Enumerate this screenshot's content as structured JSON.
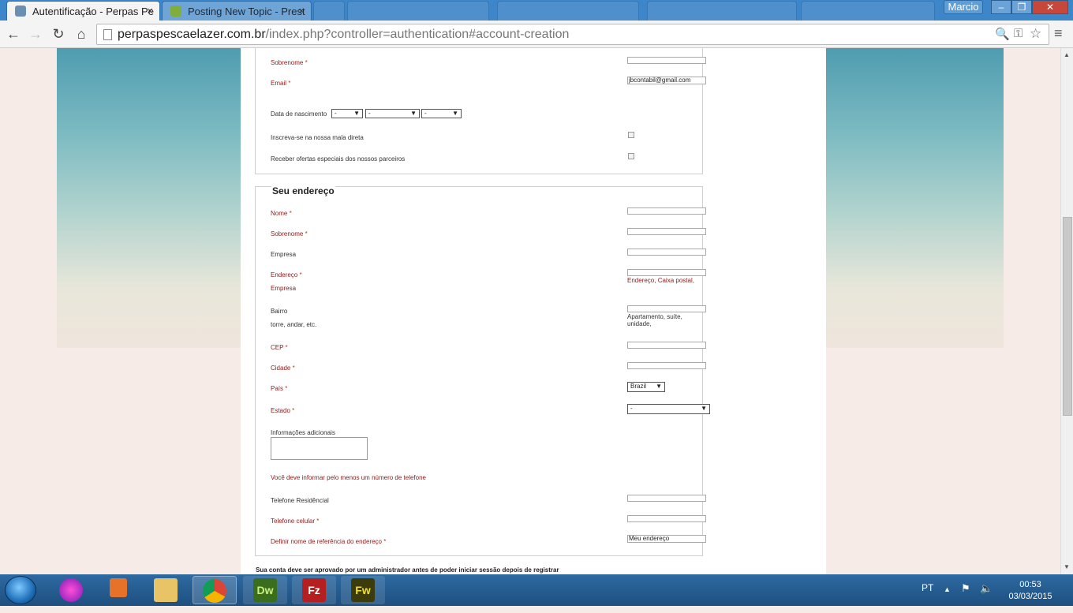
{
  "browser": {
    "tabs": [
      {
        "title": "Autentificação - Perpas Pe",
        "active": true,
        "close": "×"
      },
      {
        "title": "Posting New Topic - Prest",
        "active": false,
        "close": "×"
      }
    ],
    "user": "Marcio",
    "window_controls": {
      "minimize": "–",
      "maximize": "❐",
      "close": "✕"
    },
    "nav": {
      "back": "←",
      "forward": "→",
      "reload": "↻",
      "home": "⌂",
      "menu": "≡"
    },
    "url_domain": "perpaspescaelazer.com.br",
    "url_path": "/index.php?controller=authentication#account-creation",
    "omnibox_icons": {
      "search": "🔍",
      "key": "⚿",
      "star": "☆"
    }
  },
  "personal": {
    "surname_label": "Sobrenome",
    "email_label": "Email",
    "email_value": "jbcontabil@gmail.com",
    "birth_label": "Data de nascimento",
    "birth_day": "-",
    "birth_month": "-",
    "birth_year": "-",
    "newsletter_label": "Inscreva-se na nossa mala direta",
    "partners_label": "Receber ofertas especiais dos nossos parceiros"
  },
  "address": {
    "title": "Seu endereço",
    "name_label": "Nome",
    "surname_label": "Sobrenome",
    "company_label": "Empresa",
    "address_label": "Endereço",
    "address_sublabel": "Empresa",
    "address_hint": "Endereço, Caixa postal,",
    "district_label": "Bairro",
    "district_sublabel": "torre, andar, etc.",
    "district_hint": "Apartamento, suíte, unidade,",
    "zip_label": "CEP",
    "city_label": "Cidade",
    "country_label": "País",
    "country_value": "Brazil",
    "state_label": "Estado",
    "state_value": "-",
    "additional_label": "Informações adicionais",
    "phone_notice": "Você deve informar pelo menos um número de telefone",
    "home_phone_label": "Telefone Residêncial",
    "mobile_label": "Telefone celular",
    "alias_label": "Definir nome de referência do endereço",
    "alias_value": "Meu endereço"
  },
  "footer_note": "Sua conta deve ser aprovado por um administrador antes de poder iniciar sessão depois de registrar",
  "taskbar": {
    "apps": [
      {
        "name": "Dw",
        "color": "#3a6e1d"
      },
      {
        "name": "Fz",
        "color": "#b51f1f"
      },
      {
        "name": "Fw",
        "color": "#3b3b0c"
      }
    ],
    "language": "PT",
    "time": "00:53",
    "date": "03/03/2015"
  }
}
